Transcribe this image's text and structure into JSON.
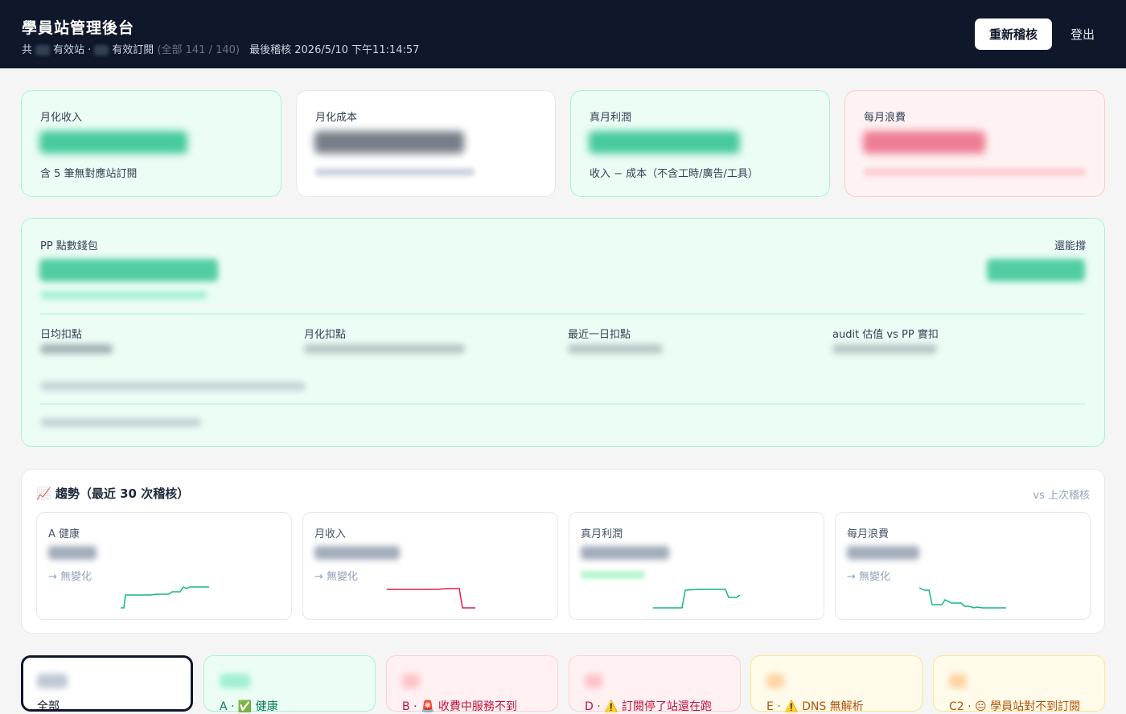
{
  "header": {
    "title": "學員站管理後台",
    "sub_total_prefix": "共",
    "sub_active_sites": "有效站 ·",
    "sub_active_subs": "有效訂閱",
    "sub_all": "(全部 141 / 140)",
    "sub_last_audit": "最後稽核 2026/5/10 下午11:14:57",
    "recheck_button": "重新稽核",
    "logout_button": "登出"
  },
  "kpis": [
    {
      "label": "月化收入",
      "note": "含 5 筆無對應站訂閱",
      "tone": "green"
    },
    {
      "label": "月化成本",
      "note": "",
      "tone": "white"
    },
    {
      "label": "真月利潤",
      "note": "收入 − 成本（不含工時/廣告/工具）",
      "tone": "green"
    },
    {
      "label": "每月浪費",
      "note": "",
      "tone": "red"
    }
  ],
  "wallet": {
    "title": "PP 點數錢包",
    "runway_label": "還能撐",
    "metrics": [
      "日均扣點",
      "月化扣點",
      "最近一日扣點",
      "audit 估值 vs PP 實扣"
    ]
  },
  "trend": {
    "title": "📈 趨勢（最近 30 次稽核）",
    "compare_label": "vs 上次稽核",
    "cards": [
      {
        "label": "A 健康",
        "change": "→ 無變化",
        "color": "#10b981"
      },
      {
        "label": "月收入",
        "change": "→ 無變化",
        "color": "#e11d48"
      },
      {
        "label": "真月利潤",
        "change": "",
        "color": "#10b981"
      },
      {
        "label": "每月浪費",
        "change": "→ 無變化",
        "color": "#10b981"
      }
    ]
  },
  "filters": [
    {
      "label": "全部",
      "color": "#0f172a"
    },
    {
      "label": "A · ✅ 健康",
      "color": "#047857"
    },
    {
      "label": "B · 🚨 收費中服務不到",
      "color": "#be123c"
    },
    {
      "label": "D · ⚠️ 訂閱停了站還在跑",
      "color": "#be123c"
    },
    {
      "label": "E · ⚠️ DNS 無解析",
      "color": "#b45309"
    },
    {
      "label": "C2 · 😐 學員站對不到訂閱",
      "color": "#b45309"
    }
  ],
  "colors": {
    "header_bg": "#0f172a",
    "green_bg": "#ecfdf5",
    "red_bg": "#fef2f2",
    "accent_green": "#10b981",
    "accent_red": "#e11d48"
  }
}
